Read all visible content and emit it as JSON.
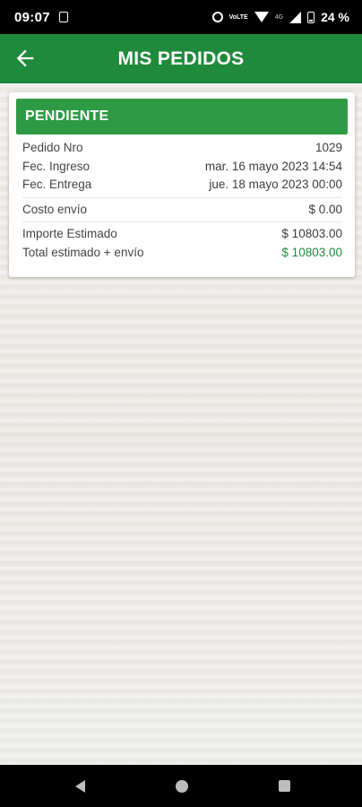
{
  "status_bar": {
    "time": "09:07",
    "lte_label": "4G",
    "volte_label": "VoLTE",
    "battery_percent": "24 %"
  },
  "app_bar": {
    "title": "MIS PEDIDOS",
    "back_icon": "arrow-left-icon",
    "color": "#1f8a3b"
  },
  "order": {
    "status": "PENDIENTE",
    "status_color": "#2f9a45",
    "details": [
      {
        "label": "Pedido Nro",
        "value": "1029"
      },
      {
        "label": "Fec. Ingreso",
        "value": "mar. 16 mayo 2023 14:54"
      },
      {
        "label": "Fec. Entrega",
        "value": "jue. 18 mayo 2023 00:00"
      }
    ],
    "shipping": {
      "label": "Costo envío",
      "value": "$ 0.00"
    },
    "totals": [
      {
        "label": "Importe Estimado",
        "value": "$ 10803.00"
      },
      {
        "label": "Total estimado + envío",
        "value": "$ 10803.00"
      }
    ]
  },
  "nav_bar": {
    "back_icon": "triangle-back-icon",
    "home_icon": "circle-home-icon",
    "recents_icon": "square-recents-icon"
  }
}
